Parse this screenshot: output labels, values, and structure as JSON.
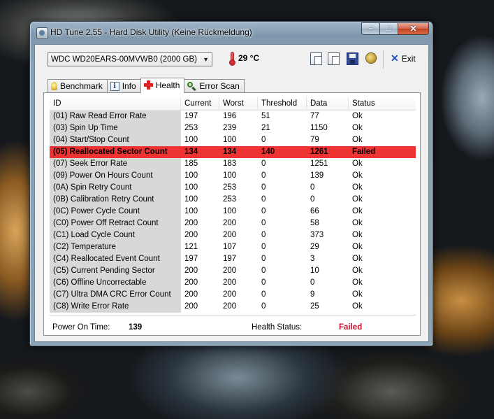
{
  "window": {
    "title": "HD Tune 2.55 - Hard Disk Utility (Keine Rückmeldung)",
    "buttons": {
      "minimize": "–",
      "maximize": "□",
      "close": "✕"
    }
  },
  "toolbar": {
    "drive": "WDC WD20EARS-00MVWB0 (2000 GB)",
    "temperature": "29 °C",
    "exit_label": "Exit"
  },
  "tabs": [
    {
      "label": "Benchmark",
      "icon": "bulb-icon"
    },
    {
      "label": "Info",
      "icon": "info-icon"
    },
    {
      "label": "Health",
      "icon": "health-cross-icon",
      "active": true
    },
    {
      "label": "Error Scan",
      "icon": "magnifier-icon"
    }
  ],
  "health": {
    "columns": [
      "ID",
      "Current",
      "Worst",
      "Threshold",
      "Data",
      "Status"
    ],
    "rows": [
      {
        "id": "(01) Raw Read Error Rate",
        "current": "197",
        "worst": "196",
        "threshold": "51",
        "data": "77",
        "status": "Ok"
      },
      {
        "id": "(03) Spin Up Time",
        "current": "253",
        "worst": "239",
        "threshold": "21",
        "data": "1150",
        "status": "Ok"
      },
      {
        "id": "(04) Start/Stop Count",
        "current": "100",
        "worst": "100",
        "threshold": "0",
        "data": "79",
        "status": "Ok"
      },
      {
        "id": "(05) Reallocated Sector Count",
        "current": "134",
        "worst": "134",
        "threshold": "140",
        "data": "1261",
        "status": "Failed",
        "failed": true
      },
      {
        "id": "(07) Seek Error Rate",
        "current": "185",
        "worst": "183",
        "threshold": "0",
        "data": "1251",
        "status": "Ok"
      },
      {
        "id": "(09) Power On Hours Count",
        "current": "100",
        "worst": "100",
        "threshold": "0",
        "data": "139",
        "status": "Ok"
      },
      {
        "id": "(0A) Spin Retry Count",
        "current": "100",
        "worst": "253",
        "threshold": "0",
        "data": "0",
        "status": "Ok"
      },
      {
        "id": "(0B) Calibration Retry Count",
        "current": "100",
        "worst": "253",
        "threshold": "0",
        "data": "0",
        "status": "Ok"
      },
      {
        "id": "(0C) Power Cycle Count",
        "current": "100",
        "worst": "100",
        "threshold": "0",
        "data": "66",
        "status": "Ok"
      },
      {
        "id": "(C0) Power Off Retract Count",
        "current": "200",
        "worst": "200",
        "threshold": "0",
        "data": "58",
        "status": "Ok"
      },
      {
        "id": "(C1) Load Cycle Count",
        "current": "200",
        "worst": "200",
        "threshold": "0",
        "data": "373",
        "status": "Ok"
      },
      {
        "id": "(C2) Temperature",
        "current": "121",
        "worst": "107",
        "threshold": "0",
        "data": "29",
        "status": "Ok"
      },
      {
        "id": "(C4) Reallocated Event Count",
        "current": "197",
        "worst": "197",
        "threshold": "0",
        "data": "3",
        "status": "Ok"
      },
      {
        "id": "(C5) Current Pending Sector",
        "current": "200",
        "worst": "200",
        "threshold": "0",
        "data": "10",
        "status": "Ok"
      },
      {
        "id": "(C6) Offline Uncorrectable",
        "current": "200",
        "worst": "200",
        "threshold": "0",
        "data": "0",
        "status": "Ok"
      },
      {
        "id": "(C7) Ultra DMA CRC Error Count",
        "current": "200",
        "worst": "200",
        "threshold": "0",
        "data": "9",
        "status": "Ok"
      },
      {
        "id": "(C8) Write Error Rate",
        "current": "200",
        "worst": "200",
        "threshold": "0",
        "data": "25",
        "status": "Ok"
      }
    ],
    "power_on_time_label": "Power On Time:",
    "power_on_time_value": "139",
    "health_status_label": "Health Status:",
    "health_status_value": "Failed"
  },
  "colors": {
    "failed_row": "#ee3333",
    "failed_text": "#c8102e"
  }
}
